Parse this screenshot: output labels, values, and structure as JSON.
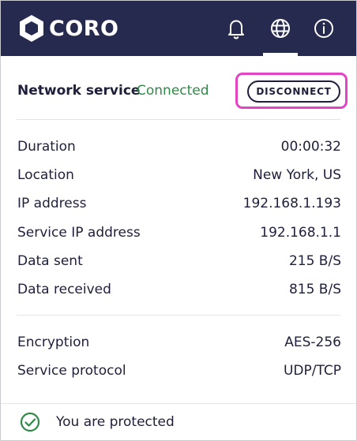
{
  "app": {
    "logo_text": "CORO"
  },
  "header": {
    "icons": [
      {
        "name": "bell-icon"
      },
      {
        "name": "globe-icon"
      },
      {
        "name": "info-icon"
      }
    ],
    "active_tab": "globe-icon"
  },
  "network": {
    "label": "Network service",
    "state": "Connected",
    "disconnect_label": "DISCONNECT"
  },
  "details": [
    {
      "label": "Duration",
      "value": "00:00:32"
    },
    {
      "label": "Location",
      "value": "New York, US"
    },
    {
      "label": "IP address",
      "value": "192.168.1.193"
    },
    {
      "label": "Service IP address",
      "value": "192.168.1.1"
    },
    {
      "label": "Data sent",
      "value": "215 B/S"
    },
    {
      "label": "Data received",
      "value": "815 B/S"
    }
  ],
  "security": [
    {
      "label": "Encryption",
      "value": "AES-256"
    },
    {
      "label": "Service protocol",
      "value": "UDP/TCP"
    }
  ],
  "footer": {
    "status_text": "You are protected"
  },
  "colors": {
    "header_bg": "#262a4f",
    "connected": "#2e8a46",
    "highlight": "#e244c4",
    "text": "#1e1f3a"
  }
}
